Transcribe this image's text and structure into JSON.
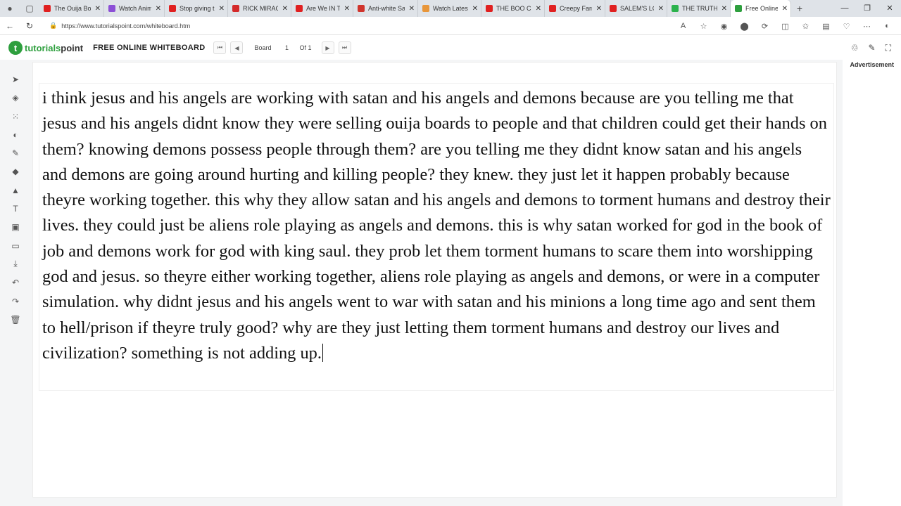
{
  "browser": {
    "tabs": [
      {
        "title": "The Ouija Boa",
        "favicon_color": "#e02020"
      },
      {
        "title": "Watch Anime",
        "favicon_color": "#8c4fd6"
      },
      {
        "title": "Stop giving th",
        "favicon_color": "#e02020"
      },
      {
        "title": "RICK MIRACLE",
        "favicon_color": "#d42a2a"
      },
      {
        "title": "Are We IN Th",
        "favicon_color": "#e02020"
      },
      {
        "title": "Anti-white Sa",
        "favicon_color": "#d0342c"
      },
      {
        "title": "Watch Latest",
        "favicon_color": "#e8963a"
      },
      {
        "title": "THE BOO CRE",
        "favicon_color": "#e02020"
      },
      {
        "title": "Creepy Farm",
        "favicon_color": "#e02020"
      },
      {
        "title": "SALEM'S LOT",
        "favicon_color": "#e02020"
      },
      {
        "title": "THE TRUTH a",
        "favicon_color": "#2bb24c"
      },
      {
        "title": "Free Online W",
        "favicon_color": "#2e9f3e"
      }
    ],
    "url": "https://www.tutorialspoint.com/whiteboard.htm"
  },
  "site": {
    "logo_main": "tutorials",
    "logo_accent": "point",
    "title": "FREE ONLINE WHITEBOARD",
    "pager": {
      "label": "Board",
      "current": "1",
      "total": "Of 1"
    }
  },
  "toolbar": {
    "tools": [
      {
        "name": "select-tool-icon",
        "glyph": "➤"
      },
      {
        "name": "layers-tool-icon",
        "glyph": "◈"
      },
      {
        "name": "grid-tool-icon",
        "glyph": "⁙"
      },
      {
        "name": "palette-tool-icon",
        "glyph": "◐"
      },
      {
        "name": "pencil-tool-icon",
        "glyph": "✎"
      },
      {
        "name": "eraser-tool-icon",
        "glyph": "◆"
      },
      {
        "name": "fill-tool-icon",
        "glyph": "▲"
      },
      {
        "name": "text-tool-icon",
        "glyph": "T"
      },
      {
        "name": "image-tool-icon",
        "glyph": "▣"
      },
      {
        "name": "projector-tool-icon",
        "glyph": "▭"
      },
      {
        "name": "download-tool-icon",
        "glyph": "⤓"
      },
      {
        "name": "undo-tool-icon",
        "glyph": "↶"
      },
      {
        "name": "redo-tool-icon",
        "glyph": "↷"
      },
      {
        "name": "trash-tool-icon",
        "glyph": "🗑"
      }
    ]
  },
  "board": {
    "text": "i think jesus and his angels are working with satan and his angels and demons because are you telling me that jesus and his angels didnt know they were selling ouija boards to people and that children could get their hands on them? knowing demons possess people through them? are you telling me they didnt know satan and his angels and demons are going around hurting and killing people? they knew. they just let it happen probably because theyre working together. this why they allow satan and his angels and demons to torment humans and destroy their lives. they could just be aliens role playing as angels and demons. this is why satan worked for god in the book of job and demons work for god with king saul. they prob let them torment humans to scare them into worshipping god and jesus. so theyre either working together, aliens role playing as angels and demons, or were in a computer simulation. why didnt jesus and his angels went to war with satan and his minions a long time ago and sent them to hell/prison if theyre truly good? why are they just letting them torment humans and destroy our lives and civilization? something is not adding up."
  },
  "ad": {
    "label": "Advertisement"
  }
}
